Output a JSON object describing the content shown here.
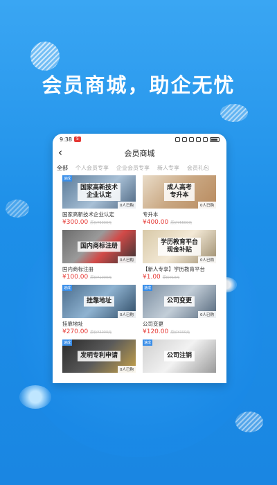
{
  "headline": "会员商城，助企无忧",
  "status": {
    "time": "9:38",
    "badge": "5"
  },
  "header": {
    "title": "会员商城",
    "back_icon": "chevron-left-icon"
  },
  "tabs": [
    {
      "label": "全部",
      "active": true
    },
    {
      "label": "个人会员专享"
    },
    {
      "label": "企业会员专享"
    },
    {
      "label": "新人专享"
    },
    {
      "label": "会员礼包"
    }
  ],
  "products": [
    {
      "caption": "国家高新技术\n企业认定",
      "name": "国家高新技术企业认定",
      "price": "¥300.00",
      "orig": "原价¥9000元",
      "sold": "0人已购",
      "tag": "速成"
    },
    {
      "caption": "成人高考\n专升本",
      "name": "专升本",
      "price": "¥400.00",
      "orig": "原价¥5500元",
      "sold": "0人已购",
      "tag": ""
    },
    {
      "caption": "国内商标注册",
      "name": "国内商标注册",
      "price": "¥100.00",
      "orig": "原价¥1000元",
      "sold": "0人已购",
      "tag": ""
    },
    {
      "caption": "学历教育平台\n现金补贴",
      "name": "【新人专享】学历教育平台",
      "price": "¥1.00",
      "orig": "原价¥10元",
      "sold": "0人已购",
      "tag": ""
    },
    {
      "caption": "挂靠地址",
      "name": "挂靠地址",
      "price": "¥270.00",
      "orig": "原价¥3000元",
      "sold": "0人已购",
      "tag": "速成"
    },
    {
      "caption": "公司变更",
      "name": "公司变更",
      "price": "¥120.00",
      "orig": "原价¥300元",
      "sold": "0人已购",
      "tag": "速成"
    },
    {
      "caption": "发明专利申请",
      "name": "",
      "price": "",
      "orig": "",
      "sold": "0人已购",
      "tag": "速成"
    },
    {
      "caption": "公司注销",
      "name": "",
      "price": "",
      "orig": "",
      "sold": "",
      "tag": "速成"
    }
  ]
}
